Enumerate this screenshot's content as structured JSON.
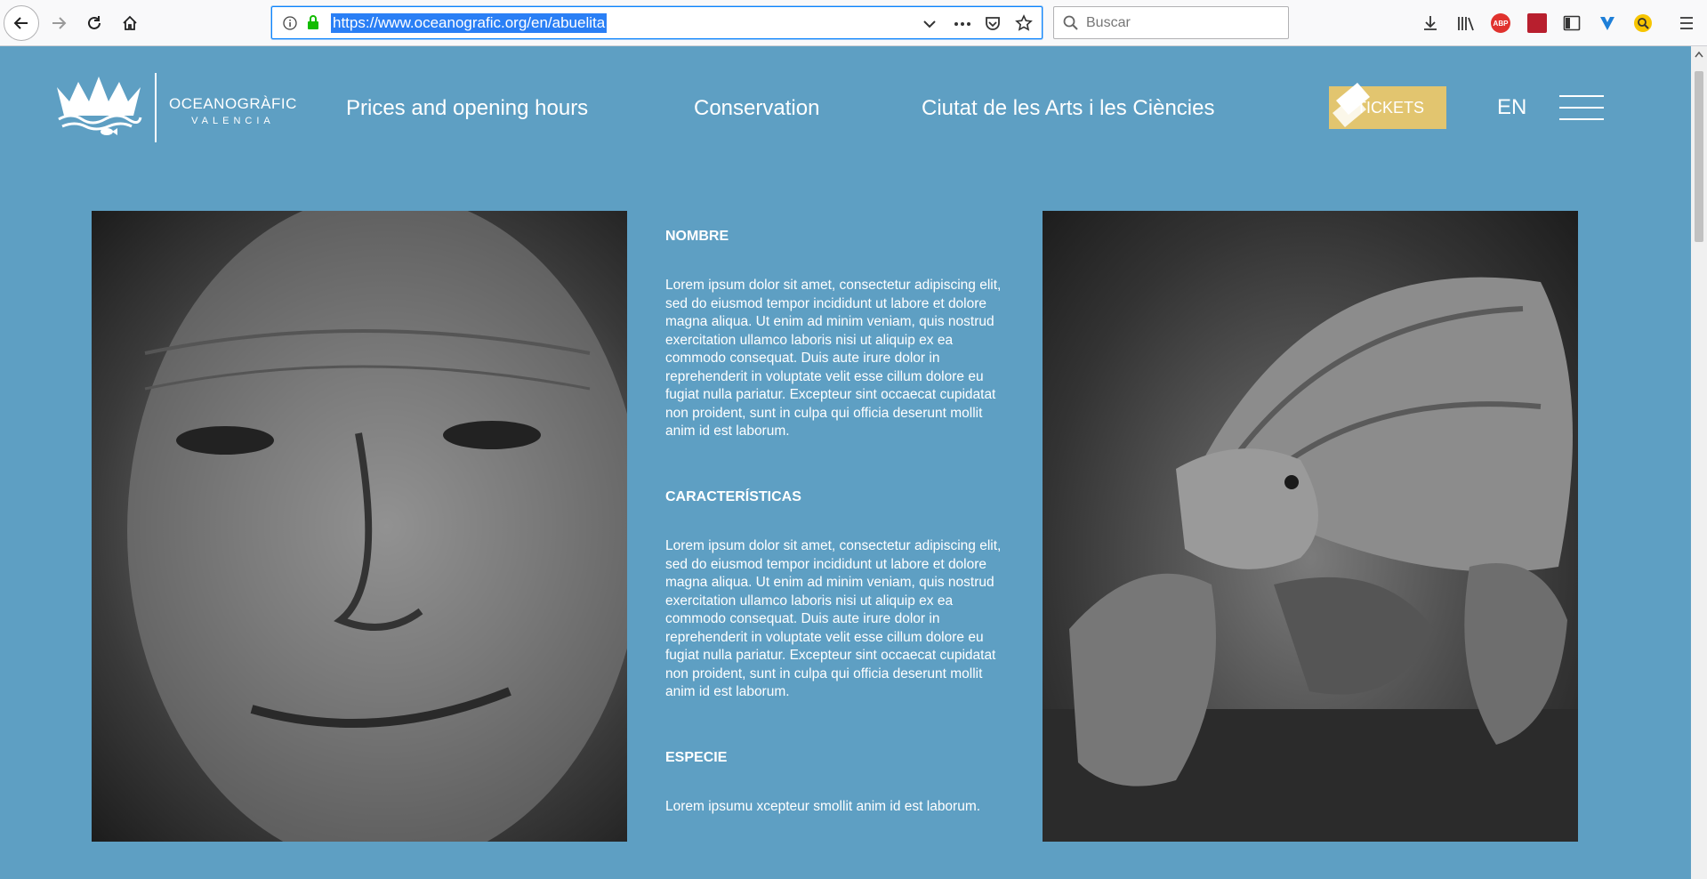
{
  "browser": {
    "url": "https://www.oceanografic.org/en/abuelita",
    "search_placeholder": "Buscar",
    "abp_label": "ABP"
  },
  "site": {
    "logo_line1": "OCEANOGRÀFIC",
    "logo_line2": "VALENCIA",
    "nav": [
      "Prices and opening hours",
      "Conservation",
      "Ciutat de les Arts i les Ciències"
    ],
    "tickets_label": "TICKETS",
    "language": "EN"
  },
  "content": {
    "sections": [
      {
        "heading": "NOMBRE",
        "body": "Lorem ipsum dolor sit amet, consectetur adipiscing elit, sed do eiusmod tempor incididunt ut labore et dolore magna aliqua. Ut enim ad minim veniam, quis nostrud exercitation ullamco laboris nisi ut aliquip ex ea commodo consequat. Duis aute irure dolor in reprehenderit in voluptate velit esse cillum dolore eu fugiat nulla pariatur. Excepteur sint occaecat cupidatat non proident, sunt in culpa qui officia deserunt mollit anim id est laborum."
      },
      {
        "heading": "CARACTERÍSTICAS",
        "body": "Lorem ipsum dolor sit amet, consectetur adipiscing elit, sed do eiusmod tempor incididunt ut labore et dolore magna aliqua. Ut enim ad minim veniam, quis nostrud exercitation ullamco laboris nisi ut aliquip ex ea commodo consequat. Duis aute irure dolor in reprehenderit in voluptate velit esse cillum dolore eu fugiat nulla pariatur. Excepteur sint occaecat cupidatat non proident, sunt in culpa qui officia deserunt mollit anim id est laborum."
      },
      {
        "heading": "ESPECIE",
        "body": "Lorem ipsumu xcepteur smollit anim id est laborum."
      }
    ]
  },
  "colors": {
    "page_bg": "#5e9fc3",
    "tickets_bg": "#e2c56f"
  }
}
